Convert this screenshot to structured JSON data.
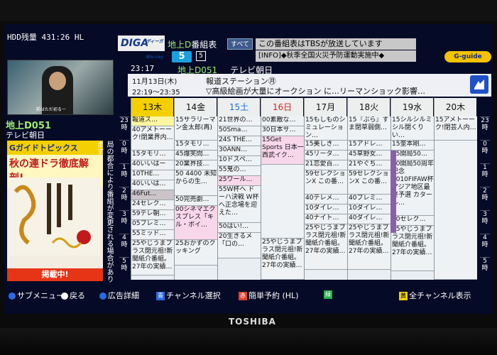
{
  "brand": "TOSHIBA",
  "hdd": "HDD残量 431:26 HL",
  "logo": {
    "main": "DIGA",
    "small": "ディーガ Blu-ray"
  },
  "title_prefix": "地上D",
  "title_suffix": "番組表",
  "channel_badge": "5",
  "channel_badge_small": "5",
  "all_button": "すべて",
  "info_line1": "この番組表はTBSが放送しています",
  "info_line2": "[INFO]◆秋季全国火災予防運動実施中◆",
  "gch_logo": "G-guide",
  "clock": "23:17",
  "current_channel_num": "地上D051",
  "current_channel_name": "テレビ朝日",
  "preview": {
    "caption": "前はただ初るー",
    "channel_num": "地上D051",
    "channel_name": "テレビ朝日"
  },
  "ad": {
    "head": "Gガイドトピックス",
    "title": "秋の連ドラ徹底解剖!",
    "footer": "掲載中!"
  },
  "side_note": "局の都合により番組が変更される場合があります",
  "detail": {
    "date": "11月13日(木)",
    "title": "報道ステーション㊊",
    "time": "22:19～23:35",
    "desc": "▽高級絵画が大量にオークション に…リーマンショック影響…"
  },
  "days": [
    "13木",
    "14金",
    "15土",
    "16日",
    "17月",
    "18火",
    "19水",
    "20木"
  ],
  "hours": [
    "23時",
    "0時",
    "1時",
    "2時",
    "3時",
    "4時",
    "5時"
  ],
  "columns": [
    {
      "cells": [
        {
          "t": "報道ス…",
          "c": "hi",
          "h": 14
        },
        {
          "t": "40アメトーーク!閉業界内…",
          "h": 34
        },
        {
          "t": "15タモリ…",
          "h": 14
        },
        {
          "t": "40いいはー",
          "h": 14
        },
        {
          "t": "10THE…",
          "h": 14
        },
        {
          "t": "40いいは…",
          "h": 14
        },
        {
          "t": "46Fut…",
          "c": "dark",
          "h": 14
        },
        {
          "t": "24セレク…",
          "h": 14
        },
        {
          "t": "59テレ朝…",
          "h": 14
        },
        {
          "t": "05プレミ…",
          "h": 14
        },
        {
          "t": "55ミッド…",
          "h": 14
        },
        {
          "t": "25やじうまプラス閉元祖!新聞紙介番組。27年の実績…",
          "h": 50
        }
      ]
    },
    {
      "cells": [
        {
          "t": "15サラリーマン金太郎(再)",
          "h": 34
        },
        {
          "t": "15タモリ…",
          "h": 14
        },
        {
          "t": "45爆笑問…",
          "h": 14
        },
        {
          "t": "20業界技…",
          "h": 14
        },
        {
          "t": "50 4400 未知からの生…",
          "h": 36
        },
        {
          "t": "50完売劇…",
          "h": 14
        },
        {
          "t": "00シネマエクスプレス「キル・ボイ…",
          "c": "pk",
          "h": 48
        },
        {
          "t": "25おかずのクッキング",
          "h": 36
        }
      ]
    },
    {
      "cells": [
        {
          "t": "21世界の…",
          "h": 14
        },
        {
          "t": "50Sma…",
          "h": 14
        },
        {
          "t": "24S THE…",
          "h": 14
        },
        {
          "t": "30ANN…",
          "h": 14
        },
        {
          "t": "10ドスペ…",
          "h": 14
        },
        {
          "t": "55鬼の…",
          "h": 14
        },
        {
          "t": "25ワール…",
          "c": "pk",
          "h": 14
        },
        {
          "t": "55W杯ヘ ドーハ決戦 W杯へ正念場を迎えた…",
          "h": 52
        },
        {
          "t": "50はい!…",
          "h": 14
        },
        {
          "t": "20生きるメ 「口の…",
          "h": 36
        }
      ]
    },
    {
      "cells": [
        {
          "t": "00素敵な…",
          "h": 14
        },
        {
          "t": "30日本サ…",
          "h": 14
        },
        {
          "t": "15Get Sports 日本一西武イク…",
          "c": "pk",
          "h": 40
        },
        {
          "t": "",
          "h": 104
        },
        {
          "t": "25やじうまプラス閉元祖!新聞紙介番組。27年の実績…",
          "h": 58
        }
      ]
    },
    {
      "cells": [
        {
          "t": "15もしものシミュレーション…",
          "h": 34
        },
        {
          "t": "15美しき…",
          "h": 14
        },
        {
          "t": "45リータ…",
          "h": 14
        },
        {
          "t": "21恋愛百…",
          "h": 14
        },
        {
          "t": "59セレクションX この番…",
          "h": 34
        },
        {
          "t": "40テレメ…",
          "h": 14
        },
        {
          "t": "10ダイレ…",
          "h": 14
        },
        {
          "t": "40ナイト…",
          "h": 14
        },
        {
          "t": "25やじうまプラス閉元祖!新聞紙介番組。27年の実績…",
          "h": 64
        }
      ]
    },
    {
      "cells": [
        {
          "t": "15『ぶら』すま閉草弱側…",
          "h": 34
        },
        {
          "t": "15アドレ…",
          "h": 14
        },
        {
          "t": "45草野女…",
          "h": 14
        },
        {
          "t": "21やぐち…",
          "h": 14
        },
        {
          "t": "59セレクションX この番…",
          "h": 34
        },
        {
          "t": "40プレミ…",
          "h": 14
        },
        {
          "t": "10ダイレ…",
          "h": 14
        },
        {
          "t": "40ダイレ…",
          "h": 14
        },
        {
          "t": "25やじうまプラス閉元祖!新聞紙介番組。27年の実績…",
          "h": 64
        }
      ]
    },
    {
      "cells": [
        {
          "t": "15シルシルミシル閉くりい…",
          "h": 34
        },
        {
          "t": "15奎本剛…",
          "h": 14
        },
        {
          "t": "45開局50…",
          "h": 14
        },
        {
          "t": "10開局50周年記念2010FIFAW杯アジア地区最終予選 カタール…",
          "c": "",
          "h": 78
        },
        {
          "t": "40セレク…",
          "h": 14
        },
        {
          "t": "25やじうまプラス閉元祖!新聞紙介番組。27年の実績…",
          "h": 64
        }
      ]
    },
    {
      "cells": [
        {
          "t": "15アメトーーク!閉芸人内…",
          "h": 34
        },
        {
          "t": "",
          "h": 196
        }
      ]
    }
  ],
  "menu": {
    "sub": "サブメニュー",
    "back": "戻る",
    "ad": "広告詳細",
    "blue_key": "青",
    "blue": "チャンネル選択",
    "red_key": "赤",
    "red": "簡単予約 (HL)",
    "green_key": "緑",
    "yellow_key": "黄",
    "yellow": "全チャンネル表示"
  }
}
